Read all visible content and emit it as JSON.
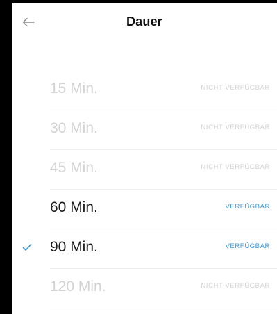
{
  "header": {
    "title": "Dauer",
    "back_icon": "arrow-left-icon"
  },
  "colors": {
    "accent": "#3a97d8",
    "disabled": "#d3d3d3",
    "text": "#1b1b1b"
  },
  "options": [
    {
      "label": "15 Min.",
      "status": "NICHT VERFÜGBAR",
      "available": false,
      "selected": false
    },
    {
      "label": "30 Min.",
      "status": "NICHT VERFÜGBAR",
      "available": false,
      "selected": false
    },
    {
      "label": "45 Min.",
      "status": "NICHT VERFÜGBAR",
      "available": false,
      "selected": false
    },
    {
      "label": "60 Min.",
      "status": "VERFÜGBAR",
      "available": true,
      "selected": false
    },
    {
      "label": "90 Min.",
      "status": "VERFÜGBAR",
      "available": true,
      "selected": true
    },
    {
      "label": "120 Min.",
      "status": "NICHT VERFÜGBAR",
      "available": false,
      "selected": false
    }
  ]
}
